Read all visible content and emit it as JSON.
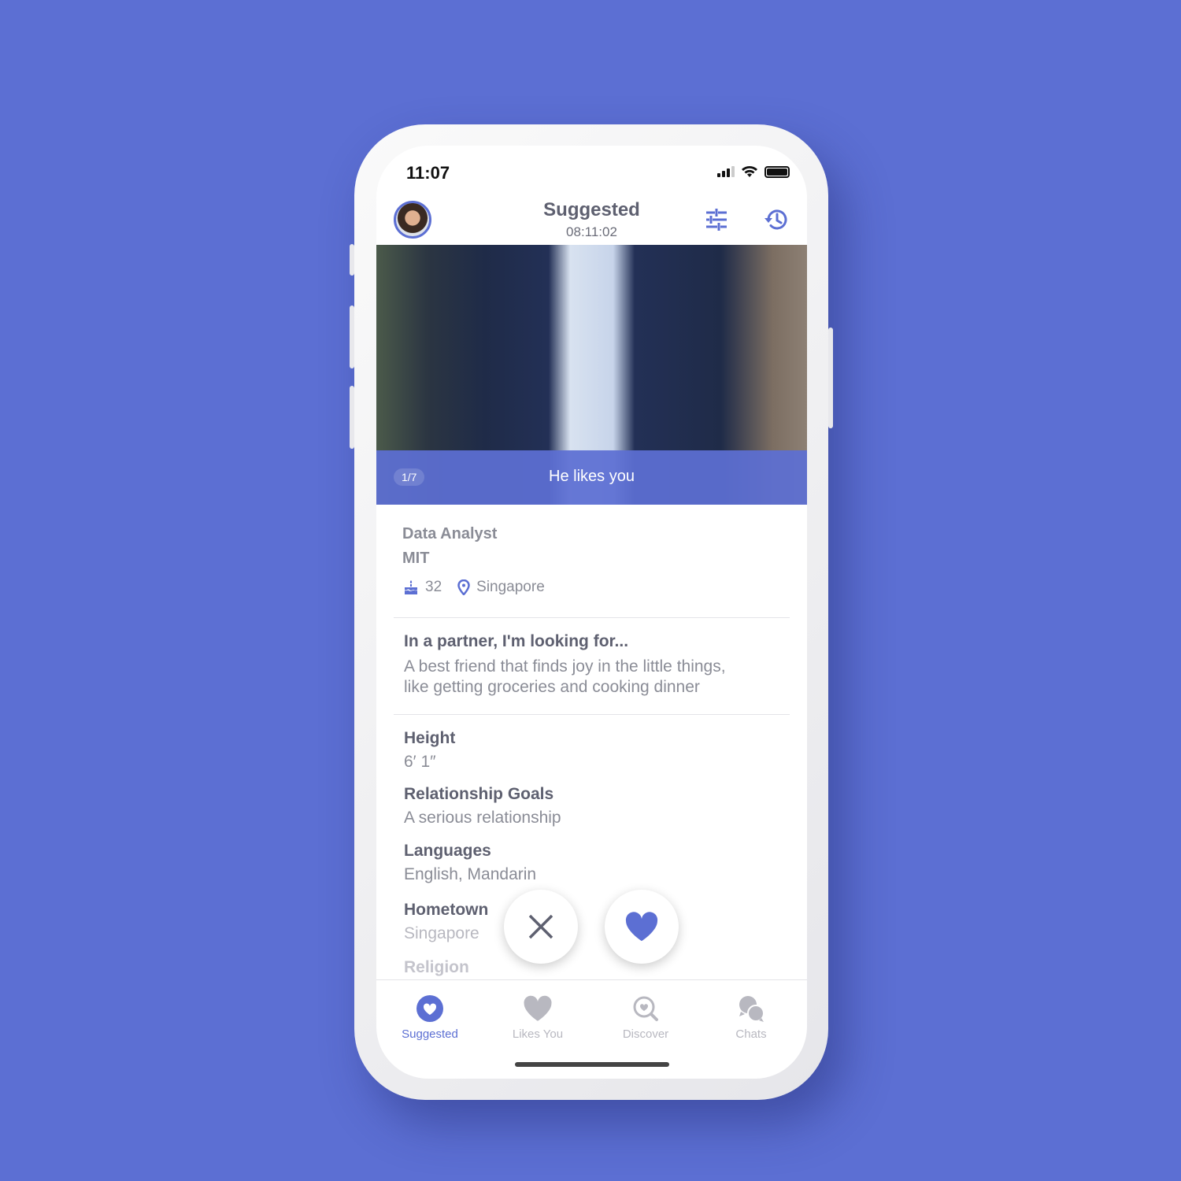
{
  "colors": {
    "background": "#5c6fd3",
    "accent": "#5c6fd3",
    "inactive": "#b8b8c0"
  },
  "status_bar": {
    "time": "11:07"
  },
  "header": {
    "title": "Suggested",
    "timer": "08:11:02",
    "filter_icon": "sliders-icon",
    "history_icon": "history-icon"
  },
  "photo": {
    "counter": "1/7",
    "banner": "He likes you"
  },
  "profile": {
    "job": "Data Analyst",
    "school": "MIT",
    "age": "32",
    "location": "Singapore"
  },
  "prompt": {
    "question": "In a partner, I'm looking for...",
    "answer_line1": "A best friend that finds joy in the little things,",
    "answer_line2": "like getting groceries and cooking dinner"
  },
  "details": [
    {
      "label": "Height",
      "value": "6′ 1″"
    },
    {
      "label": "Relationship Goals",
      "value": "A serious relationship"
    },
    {
      "label": "Languages",
      "value": "English, Mandarin"
    },
    {
      "label": "Hometown",
      "value": "Singapore"
    },
    {
      "label": "Religion",
      "value": ""
    }
  ],
  "tabs": [
    {
      "label": "Suggested",
      "active": true
    },
    {
      "label": "Likes You"
    },
    {
      "label": "Discover"
    },
    {
      "label": "Chats"
    }
  ]
}
